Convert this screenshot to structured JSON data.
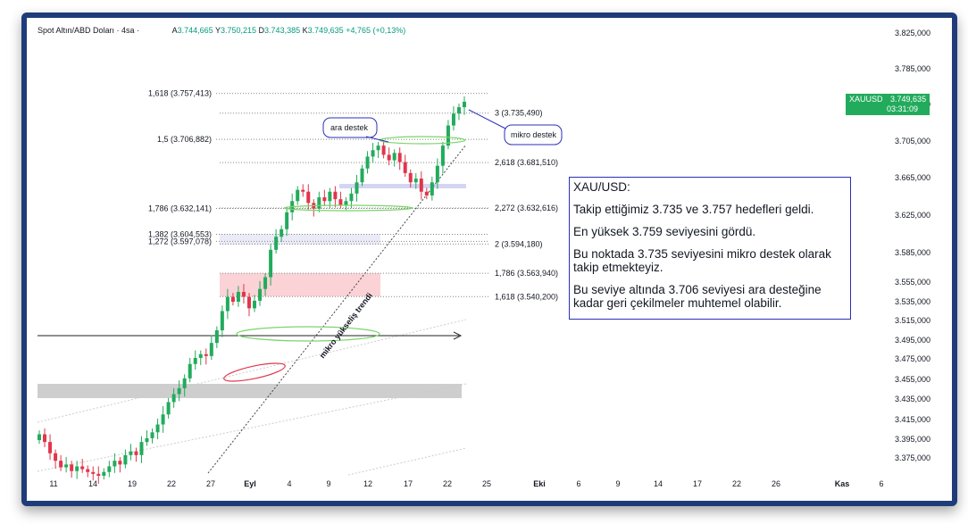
{
  "header": {
    "symbol": "Spot Altın/ABD Doları · 4sa ·",
    "o_label": "A",
    "o_value": "3.744,665",
    "h_label": "Y",
    "h_value": "3.750,215",
    "l_label": "D",
    "l_value": "3.743,385",
    "c_label": "K",
    "c_value": "3.749,635",
    "change": "+4,765 (+0,13%)"
  },
  "price_tag": {
    "symbol": "XAUUSD",
    "price": "3.749,635",
    "countdown": "03:31:09"
  },
  "note": {
    "title": "XAU/USD:",
    "lines": [
      "Takip ettiğimiz 3.735 ve 3.757 hedefleri geldi.",
      "En yüksek 3.759 seviyesini gördü.",
      "Bu noktada 3.735 seviyesini mikro destek olarak takip etmekteyiz.",
      "Bu seviye altında 3.706 seviyesi ara desteğine kadar geri çekilmeler muhtemel olabilir."
    ]
  },
  "colors": {
    "up": "#22ab5c",
    "down": "#e0364b",
    "border": "#1f3c7a",
    "note_border": "#2b2fb8"
  },
  "chart_data": {
    "type": "line",
    "title": "Spot Altın/ABD Doları · 4sa",
    "y_axis": {
      "ticks": [
        "3.825,000",
        "3.785,000",
        "3.745,000",
        "3.705,000",
        "3.665,000",
        "3.625,000",
        "3.585,000",
        "3.555,000",
        "3.535,000",
        "3.515,000",
        "3.495,000",
        "3.475,000",
        "3.455,000",
        "3.435,000",
        "3.415,000",
        "3.395,000",
        "3.375,000"
      ],
      "tick_values": [
        3825,
        3785,
        3745,
        3705,
        3665,
        3625,
        3585,
        3555,
        3535,
        3515,
        3495,
        3475,
        3455,
        3435,
        3415,
        3395,
        3375
      ]
    },
    "x_axis": {
      "ticks": [
        "11",
        "14",
        "19",
        "22",
        "27",
        "Eyl",
        "4",
        "9",
        "12",
        "17",
        "22",
        "25",
        "Eki",
        "6",
        "9",
        "14",
        "17",
        "22",
        "26",
        "Kas",
        "6"
      ]
    },
    "fib_levels_left": [
      {
        "label": "1,618 (3.757,413)",
        "value": 3757.413
      },
      {
        "label": "1,5 (3.706,882)",
        "value": 3706.882
      },
      {
        "label": "1,786 (3.632,141)",
        "value": 3632.141
      },
      {
        "label": "1,382 (3.604,553)",
        "value": 3604.553
      },
      {
        "label": "1,272 (3.597,078)",
        "value": 3597.078
      }
    ],
    "fib_levels_right": [
      {
        "label": "3 (3.735,490)",
        "value": 3735.49
      },
      {
        "label": "2,618 (3.681,510)",
        "value": 3681.51
      },
      {
        "label": "2,272 (3.632,616)",
        "value": 3632.616
      },
      {
        "label": "2 (3.594,180)",
        "value": 3594.18
      },
      {
        "label": "1,786 (3.563,940)",
        "value": 3563.94
      },
      {
        "label": "1,618 (3.540,200)",
        "value": 3540.2
      }
    ],
    "annotations": [
      "ara destek",
      "mikro destek",
      "mikro yükseliş trendi"
    ],
    "series": [
      {
        "name": "",
        "values": [
          3400,
          3392,
          3380,
          3372,
          3365,
          3368,
          3361,
          3366,
          3363,
          3360,
          3358,
          3356,
          3360,
          3366,
          3372,
          3368,
          3378,
          3382,
          3378,
          3392,
          3396,
          3402,
          3410,
          3420,
          3432,
          3440,
          3446,
          3456,
          3470,
          3476,
          3480,
          3478,
          3492,
          3505,
          3525,
          3540,
          3535,
          3545,
          3540,
          3528,
          3536,
          3548,
          3560,
          3588,
          3602,
          3610,
          3628,
          3640,
          3652,
          3650,
          3638,
          3632,
          3644,
          3640,
          3650,
          3642,
          3636,
          3640,
          3648,
          3660,
          3675,
          3688,
          3695,
          3700,
          3690,
          3684,
          3692,
          3682,
          3670,
          3660,
          3664,
          3650,
          3646,
          3660,
          3678,
          3700,
          3722,
          3735,
          3742,
          3748
        ]
      }
    ]
  }
}
